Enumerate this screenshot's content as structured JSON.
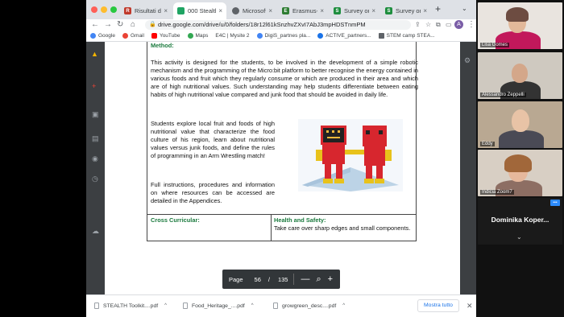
{
  "browser": {
    "tabs": [
      {
        "label": "Risultati di",
        "favicon_color": "#c0392b",
        "favicon_text": "R",
        "active": false
      },
      {
        "label": "000 Stealth",
        "favicon_color": "#1fa463",
        "favicon_text": "",
        "active": true
      },
      {
        "label": "Microsoft",
        "favicon_color": "#5f6368",
        "favicon_text": "",
        "active": false
      },
      {
        "label": "Erasmus+",
        "favicon_color": "#2e7d32",
        "favicon_text": "E",
        "active": false
      },
      {
        "label": "Survey on",
        "favicon_color": "#1e8e3e",
        "favicon_text": "S",
        "active": false
      },
      {
        "label": "Survey on",
        "favicon_color": "#1e8e3e",
        "favicon_text": "S",
        "active": false
      }
    ],
    "new_tab_icon": "+",
    "url": "drive.google.com/drive/u/0/folders/18r12l61kSnzhvZXvI7AbJ3mpHDSTnmPM",
    "profile_initial": "A",
    "bookmarks": [
      {
        "label": "Google",
        "color": "#4285f4"
      },
      {
        "label": "Gmail",
        "color": "#ea4335"
      },
      {
        "label": "YouTube",
        "color": "#ff0000"
      },
      {
        "label": "Maps",
        "color": "#34a853"
      },
      {
        "label": "E4C | Mysite 2",
        "color": "#5f6368"
      },
      {
        "label": "DigiS_partnes pla...",
        "color": "#4285f4"
      },
      {
        "label": "ACTIVE_partners...",
        "color": "#1a73e8"
      },
      {
        "label": "STEM camp STEA...",
        "color": "#5f6368"
      }
    ]
  },
  "document": {
    "method_heading": "Method:",
    "method_text": "This activity is designed for the students, to be involved in the development of a simple robotic mechanism and the programming of the Micro:bit platform to better recognise the energy contained in various foods and fruit which they regularly consume or which are produced in their area  and which are of high nutritional values.  Such understanding may help students differentiate between eating habits of high nutritional value compared and junk food that should be avoided in daily life.",
    "students_text": "Students explore local fruit and foods of high nutritional value that characterize the food culture of his region, learn about nutritional values versus junk foods, and define the rules of programming in an Arm Wrestling match!",
    "full_text": "Full instructions, procedures and information on where resources can be accessed are detailed in the Appendices.",
    "cross_curricular_label": "Cross Curricular:",
    "health_safety_heading": "Health and Safety:",
    "health_safety_text": "Take care over sharp edges and small components."
  },
  "page_control": {
    "label": "Page",
    "current": "56",
    "separator": "/",
    "total": "135",
    "zoom_out": "—",
    "zoom_in": "+"
  },
  "downloads": {
    "items": [
      {
        "name": "STEALTH Toolkit....pdf"
      },
      {
        "name": "Food_Heritage_....pdf"
      },
      {
        "name": "growgreen_desc....pdf"
      }
    ],
    "show_all": "Mostra tutto",
    "close": "✕"
  },
  "zoom_panel": {
    "participants": [
      {
        "name": "Lisa Gomes"
      },
      {
        "name": "Alessandro Zeppelli"
      },
      {
        "name": "Eddy"
      },
      {
        "name": "Indicia Zoom7"
      }
    ],
    "active_speaker": "Dominika Koper..."
  }
}
